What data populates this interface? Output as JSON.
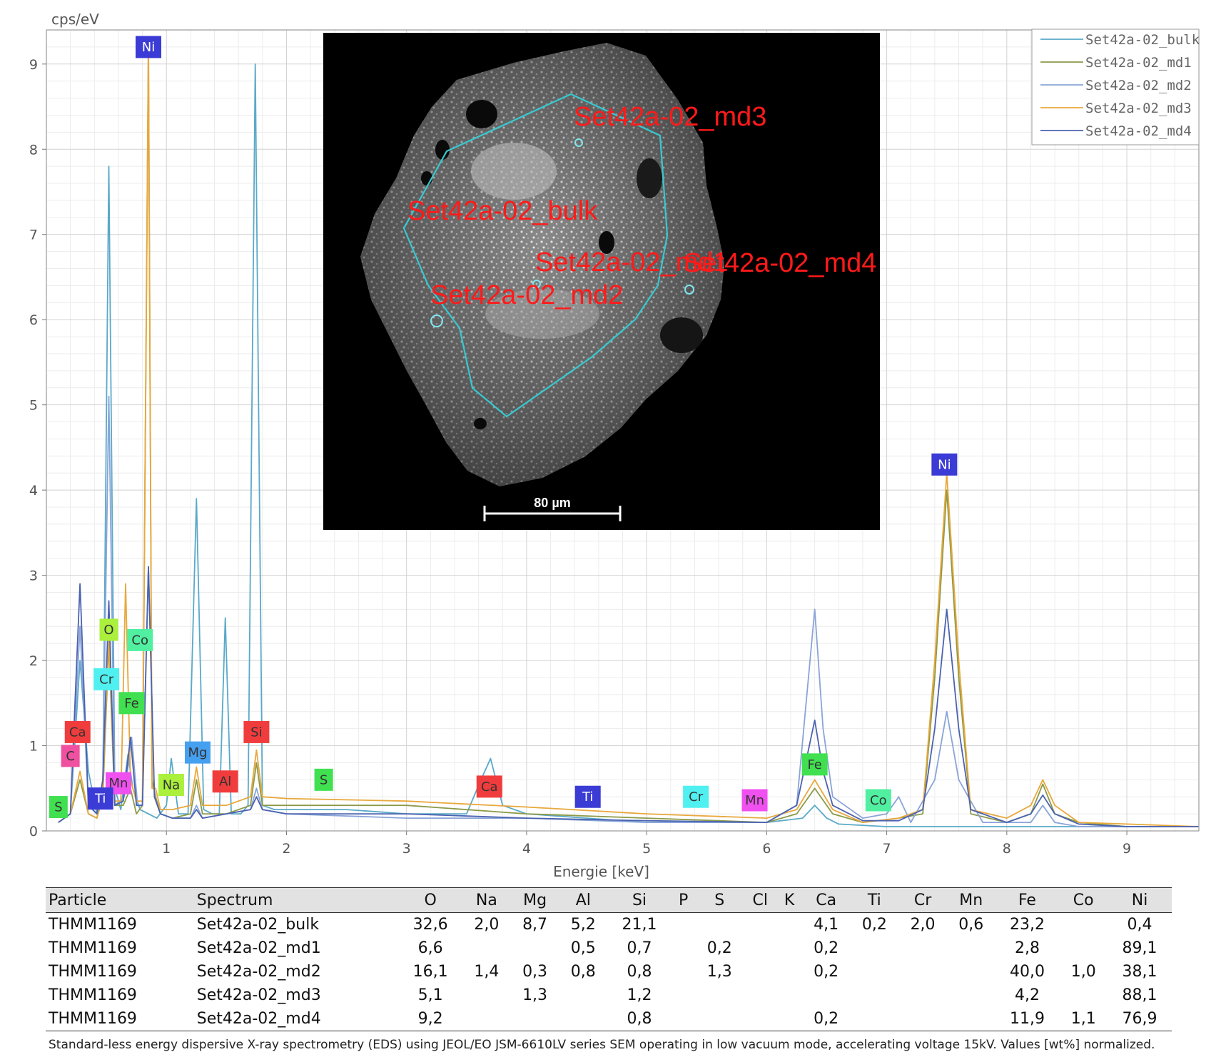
{
  "chart_data": {
    "type": "line",
    "title": "",
    "xlabel": "Energie [keV]",
    "ylabel": "cps/eV",
    "xlim": [
      0.0,
      9.6
    ],
    "ylim": [
      0,
      9.4
    ],
    "x_ticks": [
      1,
      2,
      3,
      4,
      5,
      6,
      7,
      8,
      9
    ],
    "y_ticks": [
      0,
      1,
      2,
      3,
      4,
      5,
      6,
      7,
      8,
      9
    ],
    "grid": true,
    "legend_position": "top-right",
    "series": [
      {
        "name": "Set42a-02_bulk",
        "color": "#5aa9c8",
        "x": [
          0.1,
          0.2,
          0.28,
          0.35,
          0.42,
          0.47,
          0.52,
          0.57,
          0.62,
          0.68,
          0.72,
          0.78,
          0.85,
          0.92,
          1.0,
          1.04,
          1.1,
          1.18,
          1.25,
          1.31,
          1.38,
          1.44,
          1.49,
          1.54,
          1.62,
          1.68,
          1.74,
          1.8,
          1.9,
          2.2,
          2.5,
          3.0,
          3.5,
          3.62,
          3.7,
          3.8,
          4.0,
          4.5,
          5.0,
          5.5,
          6.0,
          6.3,
          6.4,
          6.5,
          6.6,
          7.0,
          7.5,
          8.0,
          8.5,
          9.0,
          9.6
        ],
        "y": [
          0.1,
          0.2,
          2.0,
          0.7,
          0.2,
          0.5,
          7.8,
          0.5,
          0.25,
          0.9,
          0.5,
          0.25,
          0.2,
          0.15,
          0.3,
          0.85,
          0.2,
          0.2,
          3.9,
          0.25,
          0.2,
          0.2,
          2.5,
          0.2,
          0.2,
          0.3,
          9.0,
          0.3,
          0.25,
          0.25,
          0.25,
          0.2,
          0.2,
          0.6,
          0.85,
          0.3,
          0.2,
          0.15,
          0.1,
          0.1,
          0.1,
          0.15,
          0.3,
          0.15,
          0.08,
          0.05,
          0.05,
          0.05,
          0.05,
          0.05,
          0.05
        ]
      },
      {
        "name": "Set42a-02_md1",
        "color": "#8c9a48",
        "x": [
          0.1,
          0.2,
          0.28,
          0.35,
          0.42,
          0.47,
          0.52,
          0.57,
          0.64,
          0.7,
          0.75,
          0.8,
          0.85,
          0.88,
          0.91,
          0.95,
          1.05,
          1.2,
          1.25,
          1.3,
          1.5,
          1.7,
          1.75,
          1.8,
          2.0,
          3.0,
          4.0,
          5.0,
          6.0,
          6.25,
          6.4,
          6.55,
          6.8,
          7.1,
          7.3,
          7.4,
          7.5,
          7.6,
          7.7,
          8.0,
          8.2,
          8.3,
          8.4,
          8.6,
          9.0,
          9.6
        ],
        "y": [
          0.1,
          0.2,
          0.6,
          0.2,
          0.15,
          0.4,
          2.2,
          0.3,
          0.3,
          0.5,
          0.2,
          0.3,
          9.2,
          0.6,
          0.4,
          0.2,
          0.15,
          0.2,
          0.6,
          0.2,
          0.2,
          0.3,
          0.8,
          0.3,
          0.3,
          0.3,
          0.2,
          0.15,
          0.1,
          0.2,
          0.5,
          0.2,
          0.1,
          0.15,
          0.2,
          1.8,
          4.0,
          1.8,
          0.2,
          0.1,
          0.2,
          0.55,
          0.2,
          0.1,
          0.05,
          0.05
        ]
      },
      {
        "name": "Set42a-02_md2",
        "color": "#8aa4d8",
        "x": [
          0.1,
          0.2,
          0.28,
          0.35,
          0.42,
          0.47,
          0.52,
          0.57,
          0.65,
          0.71,
          0.76,
          0.8,
          0.85,
          0.9,
          0.95,
          1.05,
          1.2,
          1.25,
          1.3,
          1.5,
          1.7,
          1.75,
          1.8,
          2.0,
          3.0,
          4.0,
          5.0,
          6.0,
          6.25,
          6.4,
          6.47,
          6.55,
          6.8,
          7.0,
          7.1,
          7.2,
          7.4,
          7.5,
          7.6,
          7.8,
          8.2,
          8.3,
          8.4,
          8.6,
          9.0,
          9.6
        ],
        "y": [
          0.1,
          0.2,
          2.4,
          0.3,
          0.2,
          0.6,
          5.1,
          0.3,
          0.4,
          1.1,
          0.3,
          0.3,
          3.1,
          0.4,
          0.2,
          0.15,
          0.15,
          0.3,
          0.15,
          0.2,
          0.25,
          0.5,
          0.25,
          0.2,
          0.15,
          0.15,
          0.1,
          0.1,
          0.3,
          2.6,
          1.2,
          0.4,
          0.15,
          0.2,
          0.4,
          0.1,
          0.6,
          1.4,
          0.6,
          0.1,
          0.1,
          0.3,
          0.1,
          0.05,
          0.05,
          0.05
        ]
      },
      {
        "name": "Set42a-02_md3",
        "color": "#e8a83c",
        "x": [
          0.1,
          0.2,
          0.28,
          0.35,
          0.42,
          0.47,
          0.52,
          0.57,
          0.62,
          0.66,
          0.7,
          0.75,
          0.8,
          0.85,
          0.88,
          0.91,
          0.95,
          1.05,
          1.2,
          1.25,
          1.3,
          1.5,
          1.7,
          1.75,
          1.8,
          2.0,
          3.0,
          4.0,
          5.0,
          6.0,
          6.25,
          6.4,
          6.55,
          6.8,
          7.1,
          7.3,
          7.4,
          7.5,
          7.6,
          7.7,
          8.0,
          8.2,
          8.3,
          8.4,
          8.6,
          9.0,
          9.6
        ],
        "y": [
          0.1,
          0.2,
          0.7,
          0.2,
          0.15,
          0.5,
          2.3,
          0.35,
          0.35,
          2.9,
          0.6,
          0.35,
          0.35,
          9.3,
          0.5,
          0.5,
          0.25,
          0.25,
          0.3,
          0.75,
          0.3,
          0.3,
          0.4,
          0.95,
          0.4,
          0.38,
          0.35,
          0.28,
          0.2,
          0.15,
          0.25,
          0.6,
          0.25,
          0.1,
          0.15,
          0.25,
          2.0,
          4.2,
          2.0,
          0.25,
          0.15,
          0.3,
          0.6,
          0.3,
          0.1,
          0.08,
          0.05
        ]
      },
      {
        "name": "Set42a-02_md4",
        "color": "#4b62b0",
        "x": [
          0.1,
          0.2,
          0.28,
          0.35,
          0.42,
          0.47,
          0.52,
          0.57,
          0.64,
          0.7,
          0.75,
          0.8,
          0.85,
          0.9,
          0.95,
          1.05,
          1.2,
          1.25,
          1.3,
          1.5,
          1.7,
          1.75,
          1.8,
          2.0,
          3.0,
          4.0,
          5.0,
          6.0,
          6.25,
          6.4,
          6.47,
          6.55,
          6.8,
          7.1,
          7.3,
          7.4,
          7.5,
          7.6,
          7.7,
          8.0,
          8.2,
          8.3,
          8.4,
          8.6,
          9.0,
          9.6
        ],
        "y": [
          0.1,
          0.2,
          2.9,
          0.3,
          0.2,
          0.6,
          2.7,
          0.3,
          0.35,
          1.1,
          0.3,
          0.3,
          3.1,
          0.4,
          0.2,
          0.15,
          0.15,
          0.25,
          0.15,
          0.2,
          0.25,
          0.4,
          0.25,
          0.2,
          0.2,
          0.15,
          0.12,
          0.1,
          0.3,
          1.3,
          0.7,
          0.3,
          0.12,
          0.12,
          0.25,
          1.2,
          2.6,
          1.2,
          0.25,
          0.1,
          0.2,
          0.42,
          0.2,
          0.08,
          0.05,
          0.05
        ]
      }
    ],
    "element_labels": [
      {
        "text": "Ni",
        "x": 0.85,
        "y": 9.2,
        "color": "#3b3bd6",
        "text_color": "#ffffff"
      },
      {
        "text": "Ni",
        "x": 7.48,
        "y": 4.3,
        "color": "#3b3bd6",
        "text_color": "#ffffff"
      },
      {
        "text": "O",
        "x": 0.52,
        "y": 2.36,
        "color": "#aaf03c",
        "text_color": "#333333"
      },
      {
        "text": "Co",
        "x": 0.78,
        "y": 2.24,
        "color": "#50f0a0",
        "text_color": "#333333"
      },
      {
        "text": "Cr",
        "x": 0.5,
        "y": 1.78,
        "color": "#50f0f0",
        "text_color": "#333333"
      },
      {
        "text": "Fe",
        "x": 0.71,
        "y": 1.5,
        "color": "#40e050",
        "text_color": "#333333"
      },
      {
        "text": "Ca",
        "x": 0.26,
        "y": 1.16,
        "color": "#f03c3c",
        "text_color": "#333333"
      },
      {
        "text": "C",
        "x": 0.2,
        "y": 0.88,
        "color": "#f050a0",
        "text_color": "#333333"
      },
      {
        "text": "Si",
        "x": 1.75,
        "y": 1.16,
        "color": "#f03c3c",
        "text_color": "#333333"
      },
      {
        "text": "Mg",
        "x": 1.26,
        "y": 0.92,
        "color": "#46a0f0",
        "text_color": "#333333"
      },
      {
        "text": "Mn",
        "x": 0.6,
        "y": 0.56,
        "color": "#f050f0",
        "text_color": "#333333"
      },
      {
        "text": "Na",
        "x": 1.04,
        "y": 0.54,
        "color": "#aaf03c",
        "text_color": "#333333"
      },
      {
        "text": "Al",
        "x": 1.49,
        "y": 0.58,
        "color": "#f03c3c",
        "text_color": "#333333"
      },
      {
        "text": "S",
        "x": 2.31,
        "y": 0.6,
        "color": "#40e050",
        "text_color": "#333333"
      },
      {
        "text": "Ti",
        "x": 0.45,
        "y": 0.38,
        "color": "#3b3bd6",
        "text_color": "#ffffff"
      },
      {
        "text": "S",
        "x": 0.1,
        "y": 0.28,
        "color": "#40e050",
        "text_color": "#333333"
      },
      {
        "text": "Ca",
        "x": 3.69,
        "y": 0.52,
        "color": "#f03c3c",
        "text_color": "#333333"
      },
      {
        "text": "Ti",
        "x": 4.51,
        "y": 0.4,
        "color": "#3b3bd6",
        "text_color": "#ffffff"
      },
      {
        "text": "Cr",
        "x": 5.41,
        "y": 0.4,
        "color": "#50f0f0",
        "text_color": "#333333"
      },
      {
        "text": "Mn",
        "x": 5.9,
        "y": 0.36,
        "color": "#f050f0",
        "text_color": "#333333"
      },
      {
        "text": "Fe",
        "x": 6.4,
        "y": 0.78,
        "color": "#40e050",
        "text_color": "#333333"
      },
      {
        "text": "Co",
        "x": 6.93,
        "y": 0.36,
        "color": "#50f0a0",
        "text_color": "#333333"
      }
    ]
  },
  "sem_image": {
    "spot_labels": [
      "Set42a-02_md3",
      "Set42a-02_bulk",
      "Set42a-02_md1",
      "Set42a-02_md4",
      "Set42a-02_md2"
    ],
    "scale_bar": "80 µm"
  },
  "table": {
    "headers": [
      "Particle",
      "Spectrum",
      "O",
      "Na",
      "Mg",
      "Al",
      "Si",
      "P",
      "S",
      "Cl",
      "K",
      "Ca",
      "Ti",
      "Cr",
      "Mn",
      "Fe",
      "Co",
      "Ni"
    ],
    "rows": [
      [
        "THMM1169",
        "Set42a-02_bulk",
        "32,6",
        "2,0",
        "8,7",
        "5,2",
        "21,1",
        "",
        "",
        "",
        "",
        "4,1",
        "0,2",
        "2,0",
        "0,6",
        "23,2",
        "",
        "0,4"
      ],
      [
        "THMM1169",
        "Set42a-02_md1",
        "6,6",
        "",
        "",
        "0,5",
        "0,7",
        "",
        "0,2",
        "",
        "",
        "0,2",
        "",
        "",
        "",
        "2,8",
        "",
        "89,1"
      ],
      [
        "THMM1169",
        "Set42a-02_md2",
        "16,1",
        "1,4",
        "0,3",
        "0,8",
        "0,8",
        "",
        "1,3",
        "",
        "",
        "0,2",
        "",
        "",
        "",
        "40,0",
        "1,0",
        "38,1"
      ],
      [
        "THMM1169",
        "Set42a-02_md3",
        "5,1",
        "",
        "1,3",
        "",
        "1,2",
        "",
        "",
        "",
        "",
        "",
        "",
        "",
        "",
        "4,2",
        "",
        "88,1"
      ],
      [
        "THMM1169",
        "Set42a-02_md4",
        "9,2",
        "",
        "",
        "",
        "0,8",
        "",
        "",
        "",
        "",
        "0,2",
        "",
        "",
        "",
        "11,9",
        "1,1",
        "76,9"
      ]
    ]
  },
  "footnote": "Standard-less energy dispersive X-ray spectrometry (EDS) using JEOL/EO JSM-6610LV series SEM operating in low vacuum mode, accelerating voltage 15kV. Values [wt%] normalized."
}
